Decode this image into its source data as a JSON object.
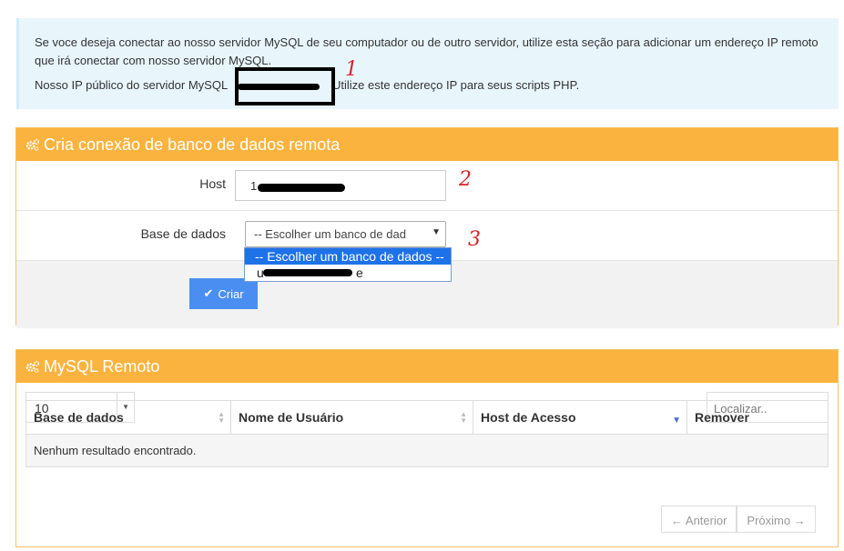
{
  "info": {
    "line1": "Se voce deseja conectar ao nosso servidor MySQL de seu computador ou de outro servidor, utilize esta seção para adicionar um endereço IP remoto que irá conectar com nosso servidor MySQL.",
    "line2_prefix": "Nosso IP público do servidor MySQL",
    "line2_suffix": "Utilize este endereço IP para seus scripts PHP."
  },
  "annotations": {
    "one": "1",
    "two": "2",
    "three": "3"
  },
  "create_panel": {
    "title": "Cria conexão de banco de dados remota",
    "host_label": "Host",
    "host_value": "1",
    "db_label": "Base de dados",
    "db_selected": "-- Escolher um banco de dad",
    "db_options": [
      "-- Escolher um banco de dados --",
      "u"
    ],
    "db_option2_tail": "e",
    "create_button": "Criar"
  },
  "remote_panel": {
    "title": "MySQL Remoto",
    "page_size": "10",
    "search_placeholder": "Localizar..",
    "columns": [
      "Base de dados",
      "Nome de Usuário",
      "Host de Acesso",
      "Remover"
    ],
    "empty_message": "Nenhum resultado encontrado.",
    "prev": "← Anterior",
    "next": "Próximo →"
  },
  "colors": {
    "panel_header": "#fbb33f",
    "button": "#4a8ef2",
    "info_bg": "#e8f6fc",
    "annotation": "#d9232a"
  },
  "icons": {
    "panel": "gears-icon",
    "button": "check-icon",
    "select": "caret-down-icon"
  }
}
